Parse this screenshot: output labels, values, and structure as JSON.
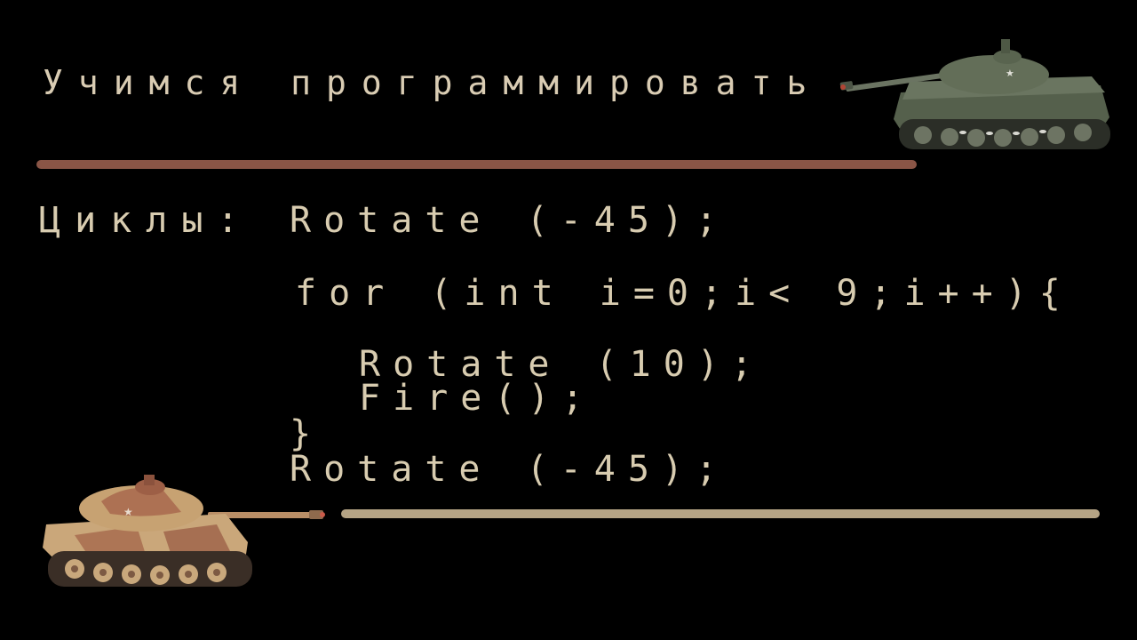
{
  "slide": {
    "title": "Учимся программировать",
    "section_label": "Циклы:",
    "code_lines": [
      "Rotate (-45);",
      "for (int i=0;i< 9;i++){",
      "Rotate (10);",
      "Fire();",
      "}",
      "Rotate (-45);"
    ]
  },
  "colors": {
    "background": "#000000",
    "text": "#d8ccb0",
    "top_rule": "#8a5546",
    "bottom_rule": "#b5a485",
    "tank_green": "#5c6652",
    "tank_camo": "#c9a878"
  },
  "images": {
    "top_tank": "green-tank-icon",
    "bottom_tank": "camo-tank-icon"
  }
}
